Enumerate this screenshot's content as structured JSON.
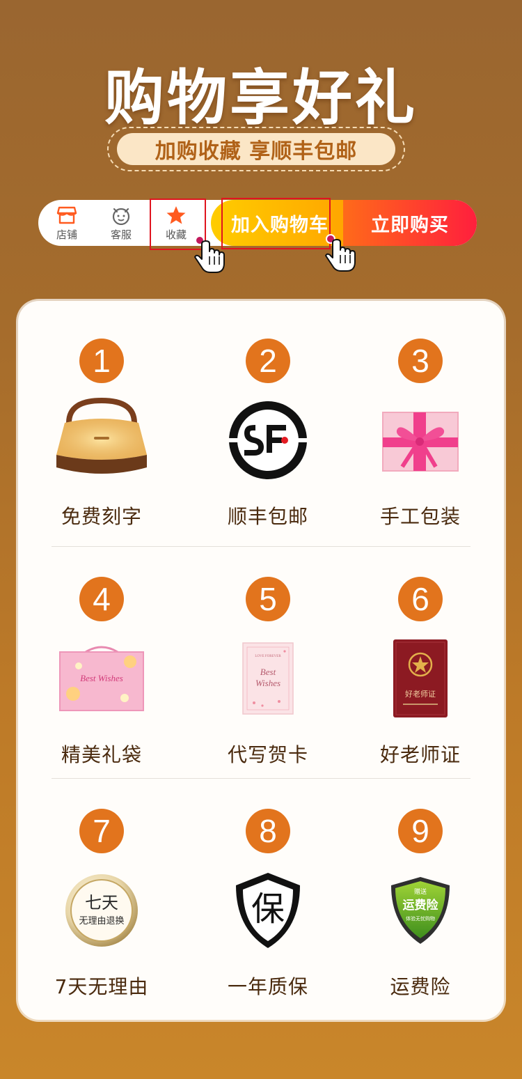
{
  "header": {
    "title": "购物享好礼",
    "subtitle": "加购收藏 享顺丰包邮"
  },
  "action_bar": {
    "nav": [
      {
        "label": "店铺",
        "icon": "shop-icon"
      },
      {
        "label": "客服",
        "icon": "customer-service-icon"
      },
      {
        "label": "收藏",
        "icon": "star-icon"
      }
    ],
    "add_to_cart": "加入购物车",
    "buy_now": "立即购买"
  },
  "benefits": [
    {
      "number": "1",
      "label": "免费刻字",
      "icon": "wooden-lamp-icon"
    },
    {
      "number": "2",
      "label": "顺丰包邮",
      "icon": "sf-express-logo"
    },
    {
      "number": "3",
      "label": "手工包装",
      "icon": "gift-box-icon"
    },
    {
      "number": "4",
      "label": "精美礼袋",
      "icon": "gift-bag-icon"
    },
    {
      "number": "5",
      "label": "代写贺卡",
      "icon": "greeting-card-icon"
    },
    {
      "number": "6",
      "label": "好老师证",
      "icon": "certificate-icon"
    },
    {
      "number": "7",
      "label": "7天无理由",
      "icon": "seven-day-return-badge-icon"
    },
    {
      "number": "8",
      "label": "一年质保",
      "icon": "warranty-shield-icon"
    },
    {
      "number": "9",
      "label": "运费险",
      "icon": "shipping-insurance-shield-icon"
    }
  ],
  "badges": {
    "seven_day_top": "七天",
    "seven_day_bottom": "无理由退换",
    "warranty_char": "保",
    "gift_bag_text": "Best Wishes",
    "card_top": "LOVE FOREVER",
    "card_main_1": "Best",
    "card_main_2": "Wishes",
    "certificate_title": "好老师证",
    "insurance_top": "赠送",
    "insurance_main": "运费险",
    "insurance_bottom": "体验无忧购物"
  },
  "colors": {
    "accent_orange": "#e2741d",
    "cart_yellow": "#ffb700",
    "buy_red": "#ff2a3a",
    "highlight_red": "#e0141e"
  }
}
